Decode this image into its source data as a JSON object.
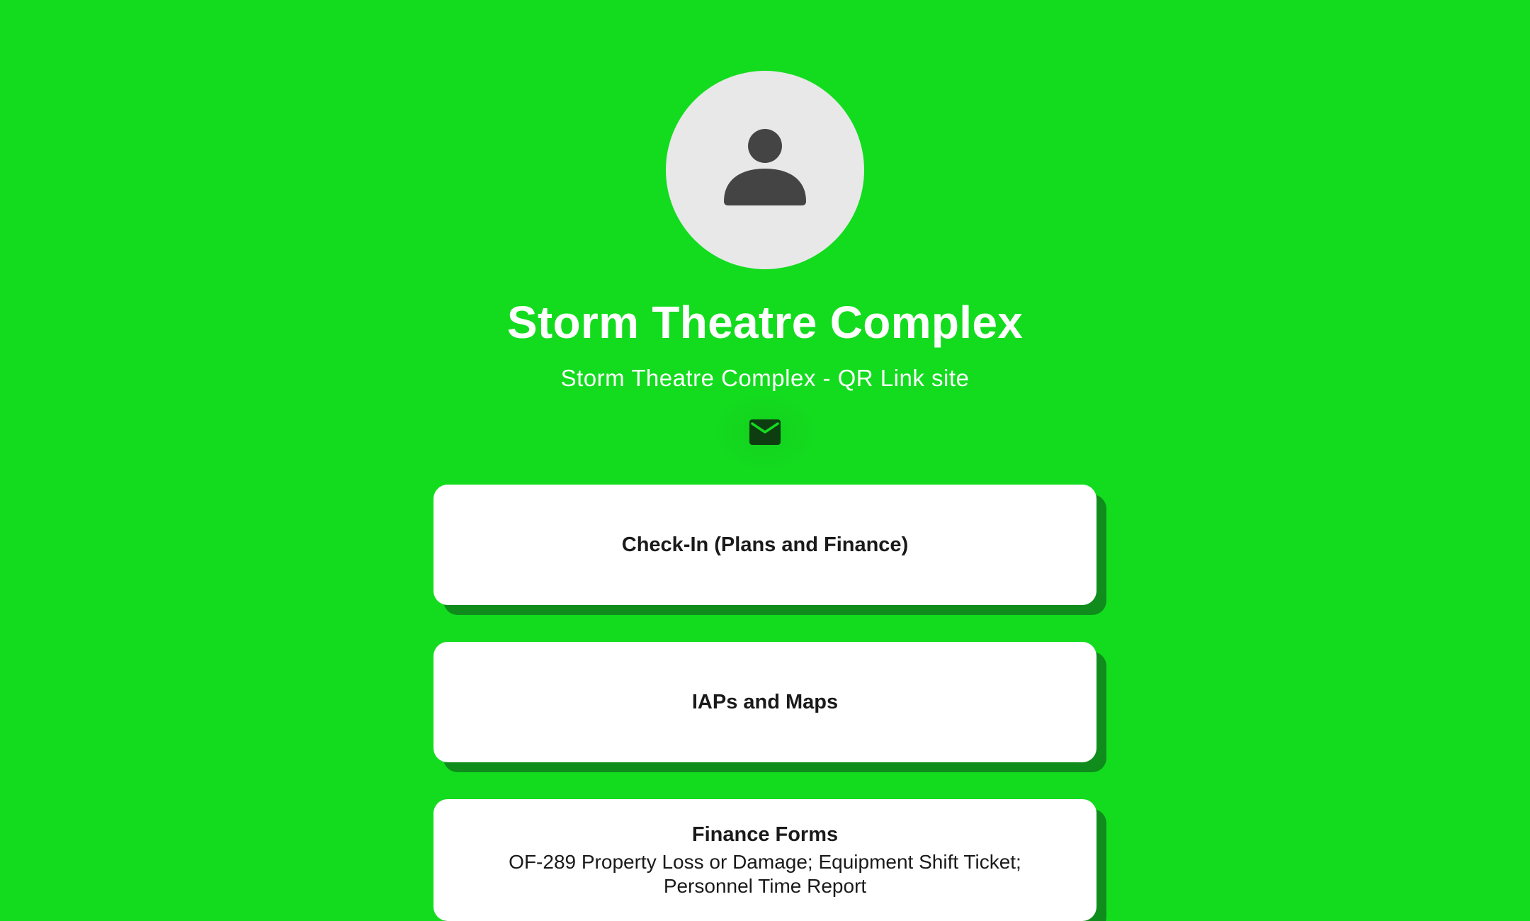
{
  "profile": {
    "avatar_icon": "user-silhouette-icon",
    "title": "Storm Theatre Complex",
    "subtitle": "Storm Theatre Complex - QR Link site"
  },
  "social": {
    "email_icon": "email-envelope-icon"
  },
  "links": [
    {
      "title": "Check-In (Plans and Finance)",
      "description": ""
    },
    {
      "title": "IAPs and Maps",
      "description": ""
    },
    {
      "title": "Finance Forms",
      "description": "OF-289 Property Loss or Damage; Equipment Shift Ticket; Personnel Time Report"
    }
  ],
  "colors": {
    "background": "#13dc1e",
    "card_shadow": "#108c1c",
    "card": "#ffffff",
    "avatar_bg": "#e8e8e8",
    "avatar_icon": "#444444"
  }
}
